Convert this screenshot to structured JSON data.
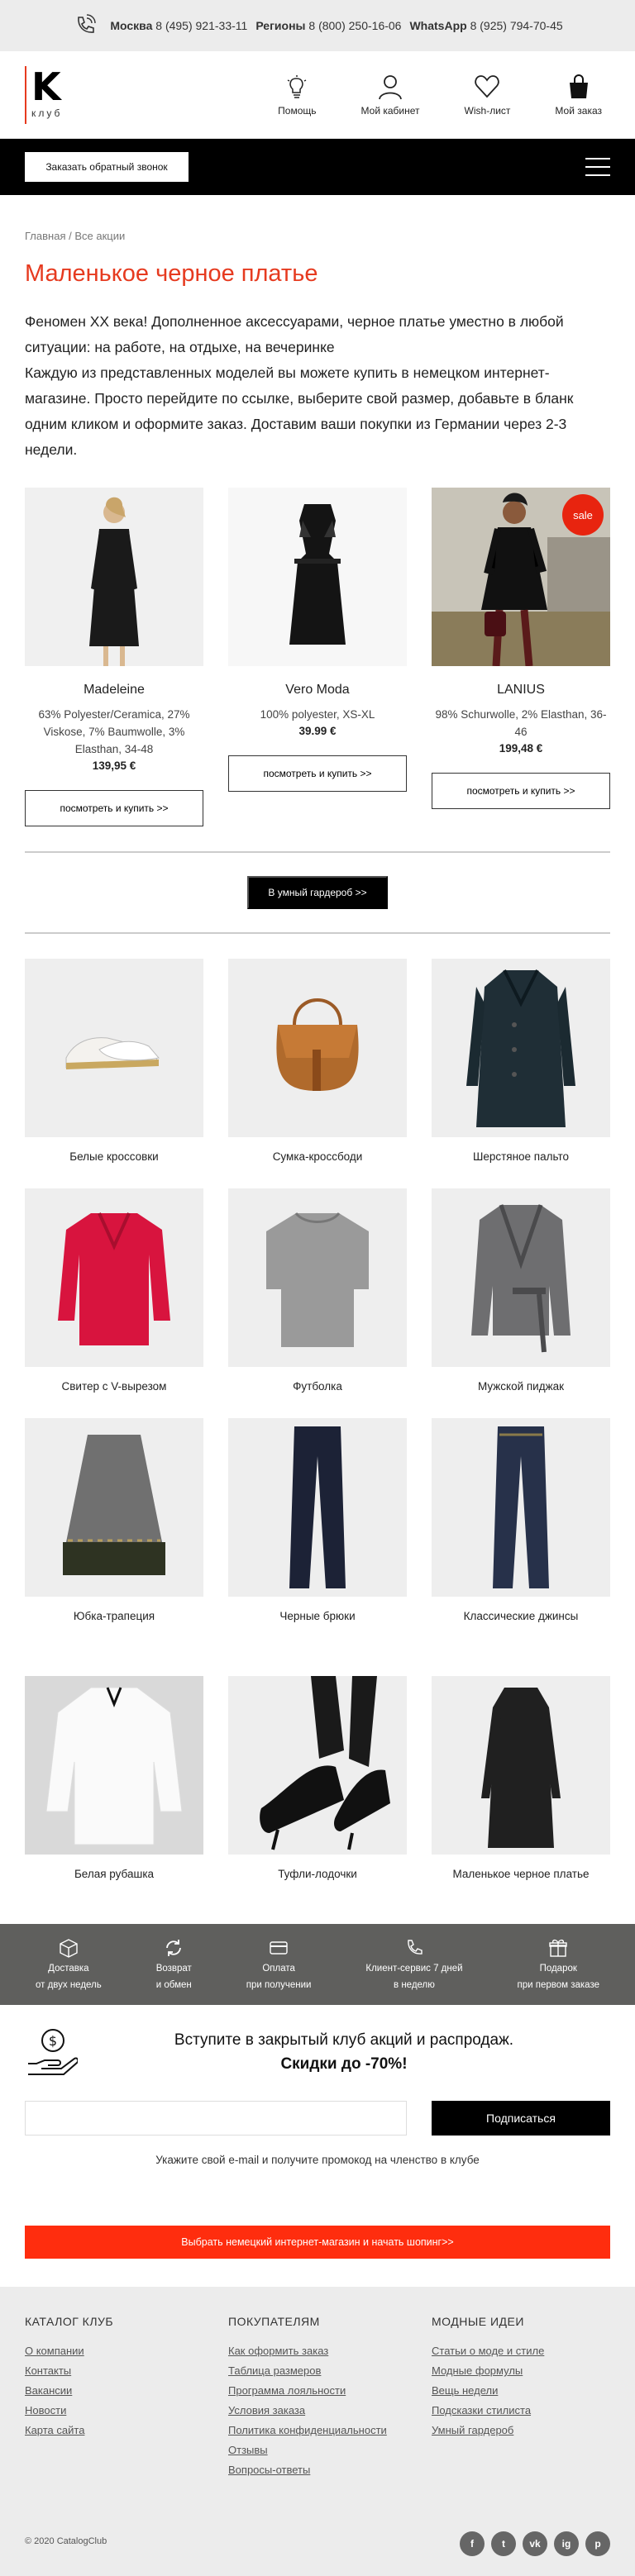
{
  "topbar": {
    "moscow_label": "Москва",
    "moscow_phone": "8 (495) 921-33-11",
    "regions_label": "Регионы",
    "regions_phone": "8 (800) 250-16-06",
    "whatsapp_label": "WhatsApp",
    "whatsapp_phone": "8 (925) 794-70-45"
  },
  "logo": {
    "letter": "K",
    "text": "клуб"
  },
  "header_nav": [
    {
      "label": "Помощь",
      "icon": "lightbulb-icon"
    },
    {
      "label": "Мой кабинет",
      "icon": "user-icon"
    },
    {
      "label": "Wish-лист",
      "icon": "heart-icon"
    },
    {
      "label": "Мой заказ",
      "icon": "bag-icon"
    }
  ],
  "callback_button": "Заказать обратный звонок",
  "breadcrumb": {
    "home": "Главная",
    "sep": "/",
    "current": "Все акции"
  },
  "page_title": "Маленькое черное платье",
  "description": [
    "Феномен XX века! Дополненное аксессуарами, черное платье уместно в любой ситуации: на работе, на отдыхе, на вечеринке",
    "Каждую из представленных моделей вы можете купить в немецком интернет-магазине. Просто перейдите по ссылке, выберите свой размер, добавьте в бланк одним кликом и оформите заказ. Доставим ваши покупки из Германии через 2-3 недели."
  ],
  "products": [
    {
      "brand": "Madeleine",
      "composition": "63% Polyester/Ceramica, 27% Viskose, 7% Baumwolle, 3% Elasthan, 34-48",
      "price": "139,95 €",
      "button": "посмотреть и купить >>",
      "sale": ""
    },
    {
      "brand": "Vero Moda",
      "composition": "100% polyester, XS-XL",
      "price": "39.99 €",
      "button": "посмотреть и купить >>",
      "sale": ""
    },
    {
      "brand": "LANIUS",
      "composition": "98% Schurwolle, 2% Elasthan, 36-46",
      "price": "199,48 €",
      "button": "посмотреть и купить >>",
      "sale": "sale"
    }
  ],
  "wardrobe_button": "В умный гардероб >>",
  "items": [
    "Белые кроссовки",
    "Сумка-кроссбоди",
    "Шерстяное пальто",
    "Свитер с V-вырезом",
    "Футболка",
    "Мужской пиджак",
    "Юбка-трапеция",
    "Черные брюки",
    "Классические джинсы",
    "Белая рубашка",
    "Туфли-лодочки",
    "Маленькое черное платье"
  ],
  "features": [
    {
      "line1": "Доставка",
      "line2": "от двух недель",
      "icon": "box-icon"
    },
    {
      "line1": "Возврат",
      "line2": "и обмен",
      "icon": "refresh-icon"
    },
    {
      "line1": "Оплата",
      "line2": "при получении",
      "icon": "card-icon"
    },
    {
      "line1": "Клиент-сервис 7 дней",
      "line2": "в неделю",
      "icon": "phone-icon"
    },
    {
      "line1": "Подарок",
      "line2": "при первом заказе",
      "icon": "gift-icon"
    }
  ],
  "promo": {
    "line1": "Вступите в закрытый клуб акций и распродаж.",
    "line2": "Скидки до -70%!",
    "input_placeholder": "",
    "button": "Подписаться",
    "hint": "Укажите свой e-mail и получите промокод на членство в клубе"
  },
  "orange_button": "Выбрать немецкий интернет-магазин и начать шопинг>>",
  "footer": {
    "columns": [
      {
        "title": "КАТАЛОГ КЛУБ",
        "links": [
          "О компании",
          "Контакты",
          "Вакансии",
          "Новости",
          "Карта сайта"
        ]
      },
      {
        "title": "ПОКУПАТЕЛЯМ",
        "links": [
          "Как оформить заказ",
          "Таблица размеров",
          "Программа лояльности",
          "Условия заказа",
          "Политика конфиденциальности",
          "Отзывы",
          "Вопросы-ответы"
        ]
      },
      {
        "title": "МОДНЫЕ ИДЕИ",
        "links": [
          "Статьи о моде и стиле",
          "Модные формулы",
          "Вещь недели",
          "Подсказки стилиста",
          "Умный гардероб"
        ]
      }
    ],
    "copyright": "© 2020 CatalogClub",
    "social": [
      "f",
      "t",
      "vk",
      "ig",
      "p"
    ]
  },
  "colors": {
    "accent": "#e63a1f",
    "orange": "#ff2d0e",
    "dark": "#000000",
    "feature_bg": "#5f5f5d"
  }
}
